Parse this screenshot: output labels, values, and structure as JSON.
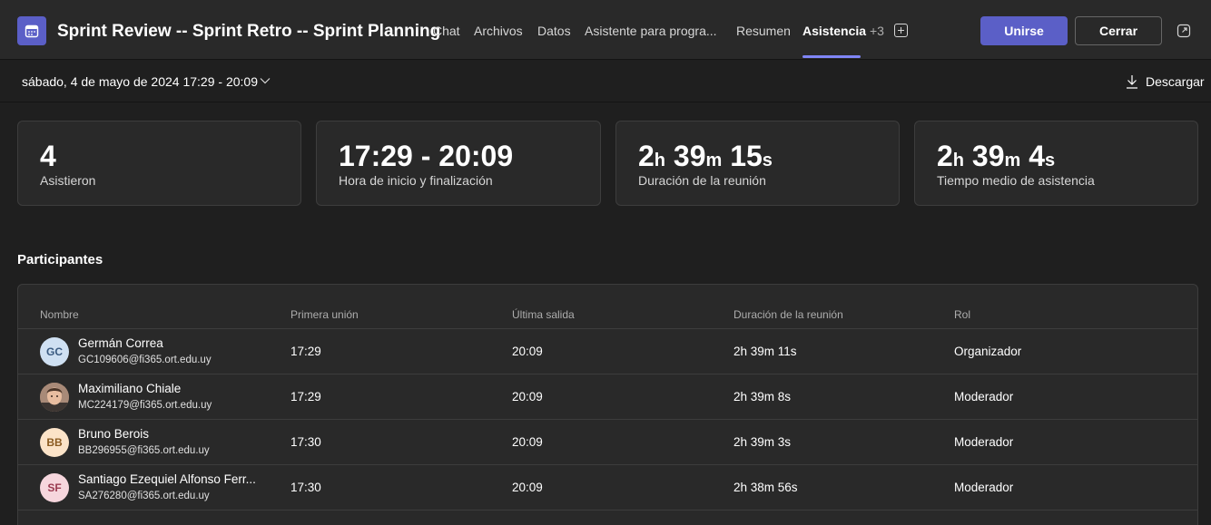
{
  "header": {
    "title": "Sprint Review -- Sprint Retro -- Sprint Planning",
    "icon": "calendar-icon",
    "tabs": [
      {
        "label": "Chat",
        "active": false
      },
      {
        "label": "Archivos",
        "active": false
      },
      {
        "label": "Datos",
        "active": false
      },
      {
        "label": "Asistente para progra...",
        "active": false
      },
      {
        "label": "Resumen",
        "active": false
      },
      {
        "label": "Asistencia",
        "active": true
      }
    ],
    "more_tabs": "+3",
    "join_label": "Unirse",
    "close_label": "Cerrar",
    "accent_color": "#5b5fc7"
  },
  "subbar": {
    "date_range": "sábado, 4 de mayo de 2024 17:29 - 20:09",
    "download_label": "Descargar"
  },
  "stats": {
    "attended": {
      "value": "4",
      "label": "Asistieron"
    },
    "time": {
      "value": "17:29 - 20:09",
      "label": "Hora de inicio y finalización"
    },
    "duration": {
      "h": "2",
      "m": "39",
      "s": "15",
      "label": "Duración de la reunión"
    },
    "average": {
      "h": "2",
      "m": "39",
      "s": "4",
      "label": "Tiempo medio de asistencia"
    },
    "units": {
      "h": "h",
      "m": "m",
      "s": "s"
    }
  },
  "participants": {
    "title": "Participantes",
    "columns": [
      "Nombre",
      "Primera unión",
      "Última salida",
      "Duración de la reunión",
      "Rol"
    ],
    "rows": [
      {
        "initials": "GC",
        "name": "Germán Correa",
        "email": "GC109606@fi365.ort.edu.uy",
        "first_join": "17:29",
        "last_leave": "20:09",
        "duration": "2h 39m 11s",
        "role": "Organizador"
      },
      {
        "initials": "",
        "name": "Maximiliano Chiale",
        "email": "MC224179@fi365.ort.edu.uy",
        "first_join": "17:29",
        "last_leave": "20:09",
        "duration": "2h 39m 8s",
        "role": "Moderador"
      },
      {
        "initials": "BB",
        "name": "Bruno Berois",
        "email": "BB296955@fi365.ort.edu.uy",
        "first_join": "17:30",
        "last_leave": "20:09",
        "duration": "2h 39m 3s",
        "role": "Moderador"
      },
      {
        "initials": "SF",
        "name": "Santiago Ezequiel Alfonso Ferr...",
        "email": "SA276280@fi365.ort.edu.uy",
        "first_join": "17:30",
        "last_leave": "20:09",
        "duration": "2h 38m 56s",
        "role": "Moderador"
      }
    ]
  }
}
